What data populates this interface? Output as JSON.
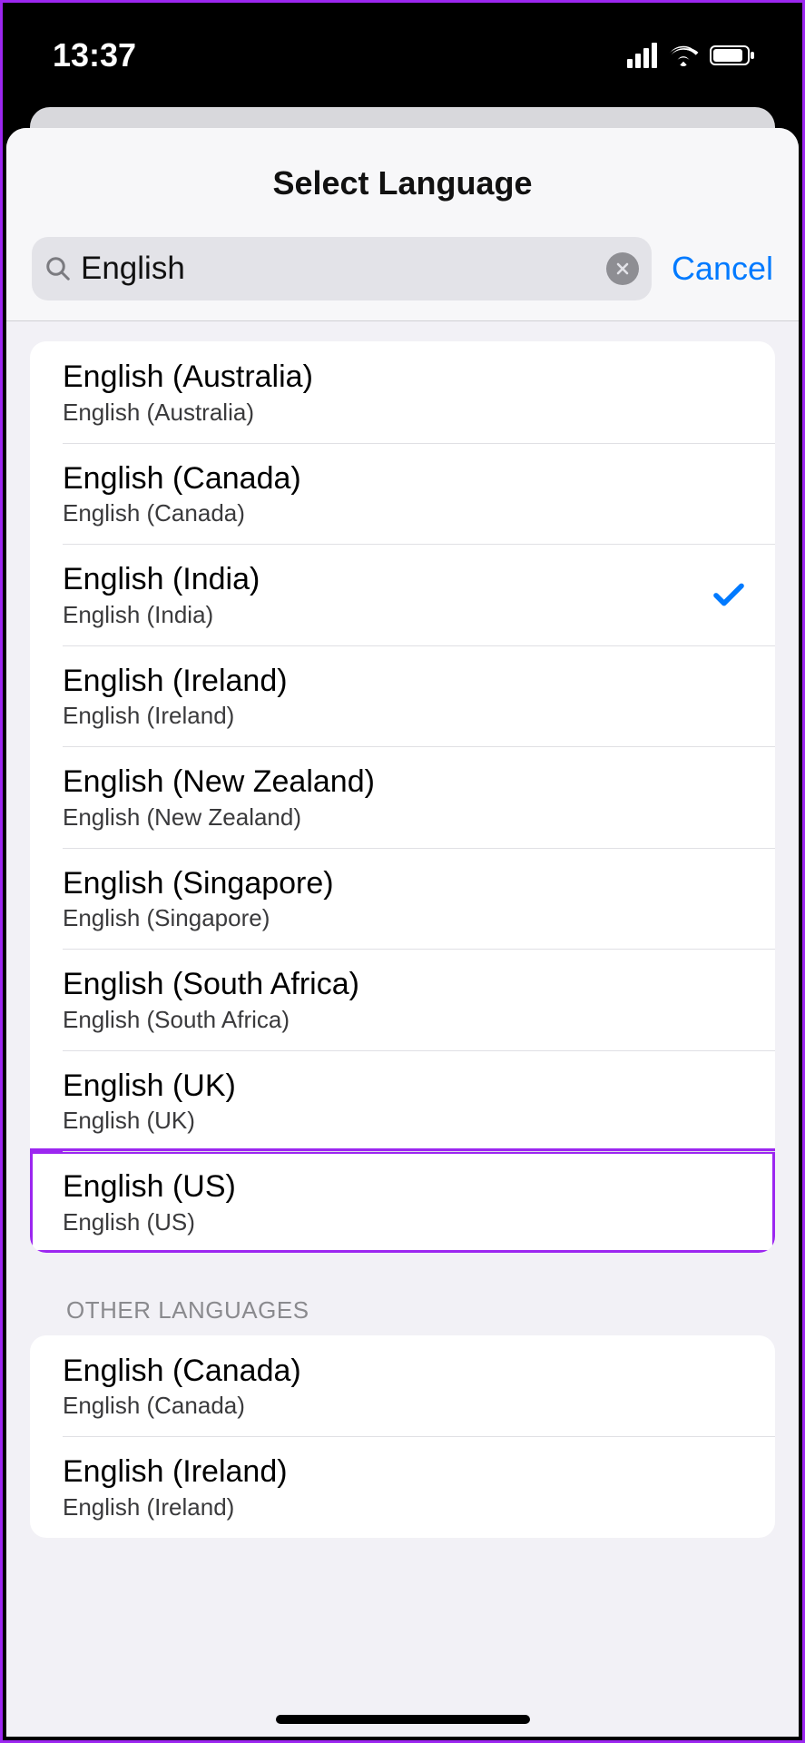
{
  "status": {
    "time": "13:37"
  },
  "header": {
    "title": "Select Language",
    "cancel_label": "Cancel"
  },
  "search": {
    "value": "English"
  },
  "results": [
    {
      "title": "English (Australia)",
      "sub": "English (Australia)",
      "selected": false,
      "highlight": false
    },
    {
      "title": "English (Canada)",
      "sub": "English (Canada)",
      "selected": false,
      "highlight": false
    },
    {
      "title": "English (India)",
      "sub": "English (India)",
      "selected": true,
      "highlight": false
    },
    {
      "title": "English (Ireland)",
      "sub": "English (Ireland)",
      "selected": false,
      "highlight": false
    },
    {
      "title": "English (New Zealand)",
      "sub": "English (New Zealand)",
      "selected": false,
      "highlight": false
    },
    {
      "title": "English (Singapore)",
      "sub": "English (Singapore)",
      "selected": false,
      "highlight": false
    },
    {
      "title": "English (South Africa)",
      "sub": "English (South Africa)",
      "selected": false,
      "highlight": false
    },
    {
      "title": "English (UK)",
      "sub": "English (UK)",
      "selected": false,
      "highlight": false
    },
    {
      "title": "English (US)",
      "sub": "English (US)",
      "selected": false,
      "highlight": true
    }
  ],
  "other_section": {
    "label": "OTHER LANGUAGES",
    "items": [
      {
        "title": "English (Canada)",
        "sub": "English (Canada)"
      },
      {
        "title": "English (Ireland)",
        "sub": "English (Ireland)"
      }
    ]
  }
}
